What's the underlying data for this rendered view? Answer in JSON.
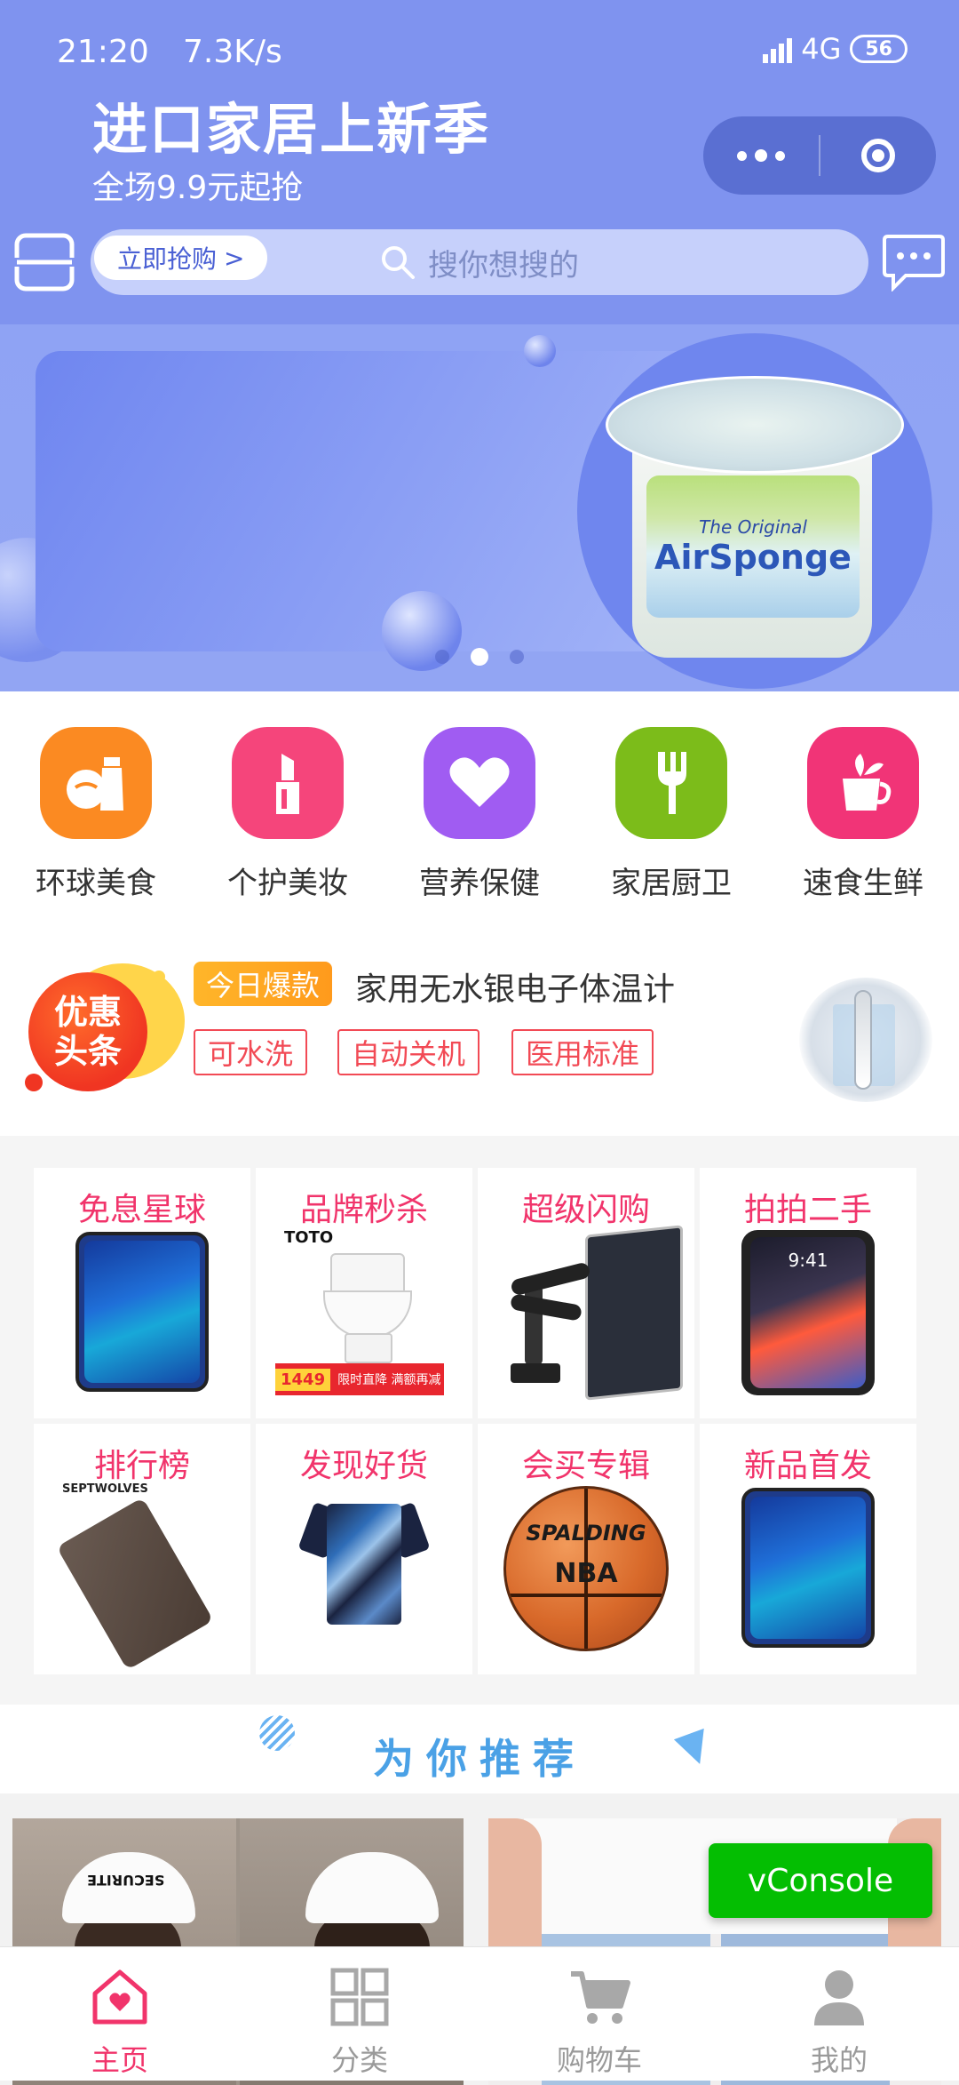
{
  "status_bar": {
    "time": "21:20",
    "speed": "7.3K/s",
    "network": "4G",
    "battery": "56"
  },
  "search": {
    "placeholder": "搜你想搜的"
  },
  "banner": {
    "title": "进口家居上新季",
    "subtitle": "全场9.9元起抢",
    "button": "立即抢购",
    "button_arrow": ">",
    "product_label_top": "The Original",
    "product_label_brand": "AirSponge",
    "active_dot": 1,
    "dot_count": 3
  },
  "categories": [
    {
      "label": "环球美食",
      "icon": "food-icon",
      "color": "#fb8a22"
    },
    {
      "label": "个护美妆",
      "icon": "lipstick-icon",
      "color": "#f5457b"
    },
    {
      "label": "营养保健",
      "icon": "heart-icon",
      "color": "#a05cf2"
    },
    {
      "label": "家居厨卫",
      "icon": "fork-icon",
      "color": "#7cbc1a"
    },
    {
      "label": "速食生鲜",
      "icon": "cup-icon",
      "color": "#f13477"
    }
  ],
  "promo": {
    "badge_line1": "优惠",
    "badge_line2": "头条",
    "hot_tag": "今日爆款",
    "title": "家用无水银电子体温计",
    "tags": [
      "可水洗",
      "自动关机",
      "医用标准"
    ]
  },
  "grid": [
    {
      "title": "免息星球",
      "image": "phone"
    },
    {
      "title": "品牌秒杀",
      "image": "toilet",
      "brand": "TOTO",
      "price": "1449",
      "promo": "限时直降 满额再减"
    },
    {
      "title": "超级闪购",
      "image": "monitor-arm"
    },
    {
      "title": "拍拍二手",
      "image": "iphone",
      "time": "9:41"
    },
    {
      "title": "排行榜",
      "image": "wallet",
      "brand": "SEPTWOLVES"
    },
    {
      "title": "发现好货",
      "image": "tshirt"
    },
    {
      "title": "会买专辑",
      "image": "basketball",
      "ball_brand": "SPALDING",
      "ball_mark": "NBA"
    },
    {
      "title": "新品首发",
      "image": "phone"
    }
  ],
  "recommend": {
    "title": "为你推荐"
  },
  "feed": {
    "cap_text": "SECURITE"
  },
  "vconsole": "vConsole",
  "tabs": [
    {
      "label": "主页",
      "icon": "home-icon",
      "active": true
    },
    {
      "label": "分类",
      "icon": "grid-icon",
      "active": false
    },
    {
      "label": "购物车",
      "icon": "cart-icon",
      "active": false
    },
    {
      "label": "我的",
      "icon": "user-icon",
      "active": false
    }
  ],
  "colors": {
    "header": "#7f93ef",
    "accent": "#f1346b",
    "recommend": "#4aa1e6",
    "vconsole": "#04be02"
  }
}
